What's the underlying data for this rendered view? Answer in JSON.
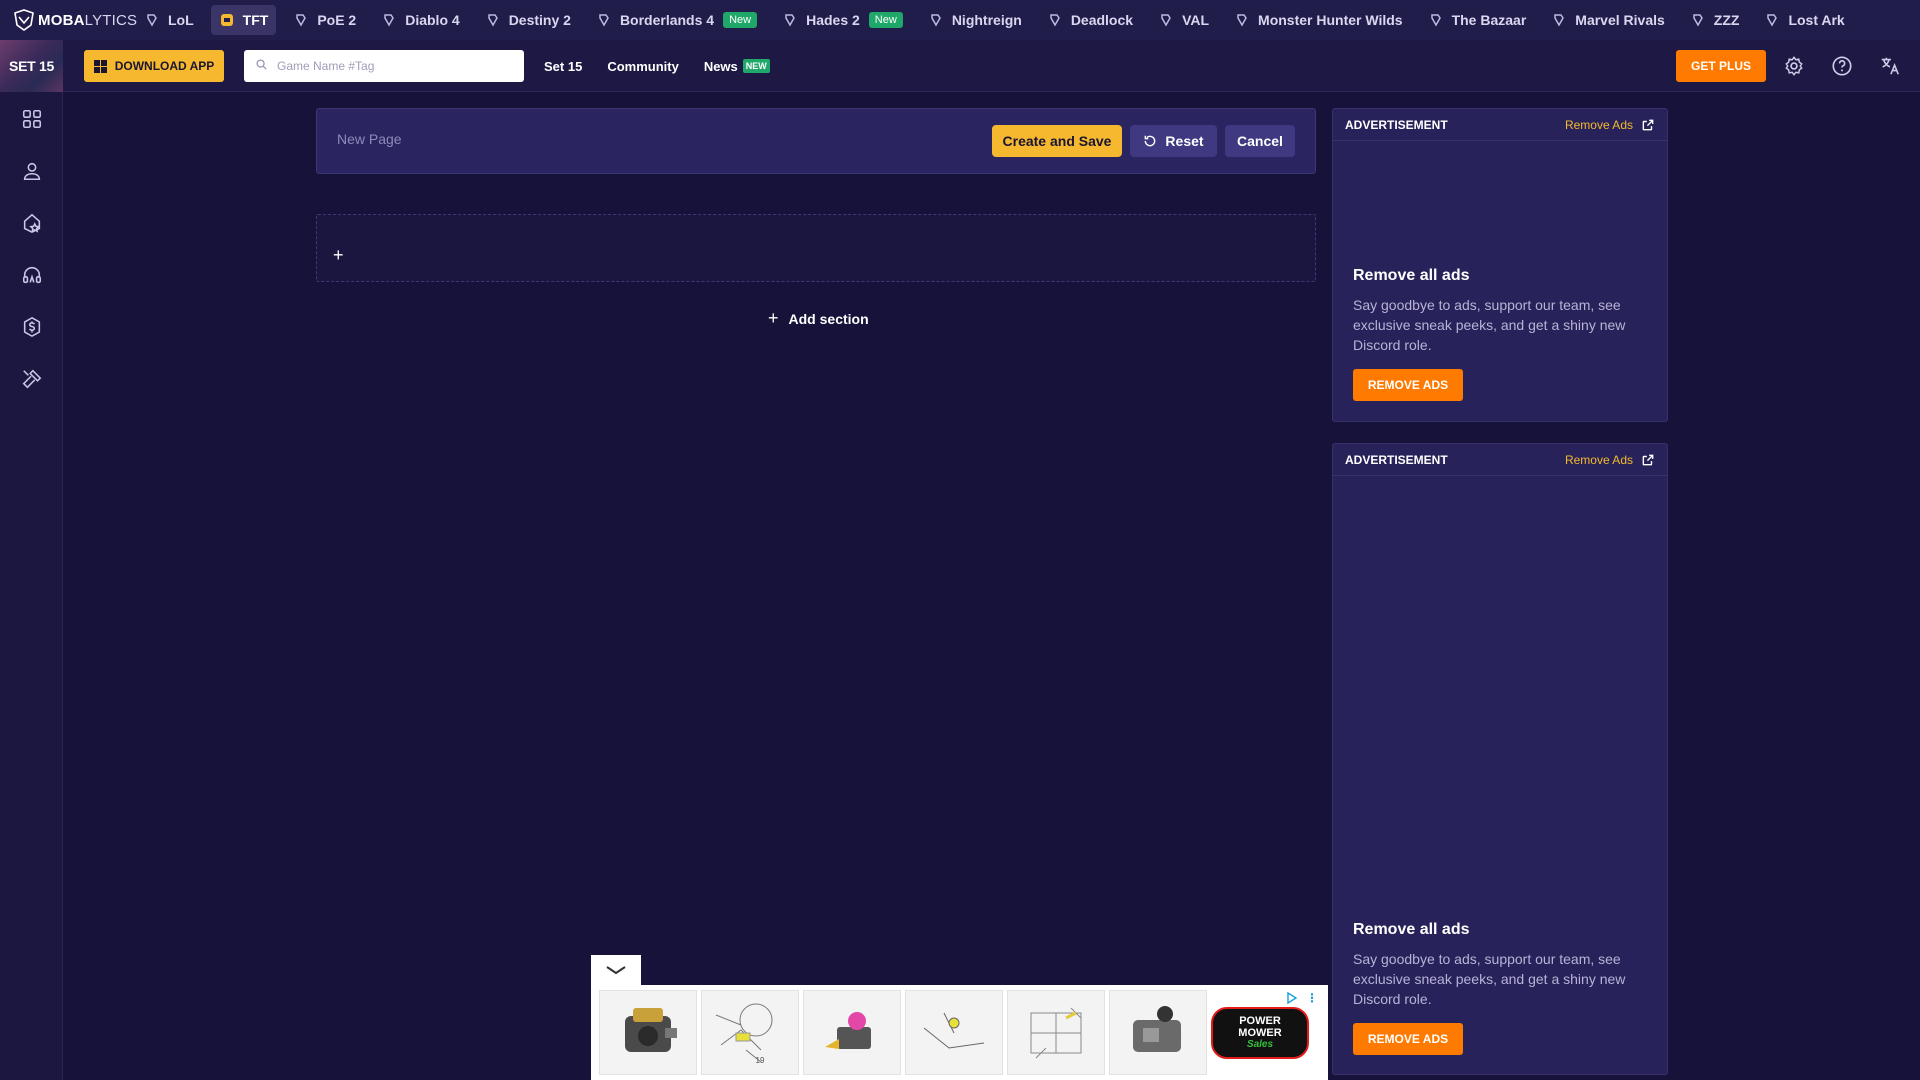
{
  "brand": {
    "bold": "MOBA",
    "thin": "LYTICS"
  },
  "games": [
    {
      "label": "LoL",
      "icon": "lol-icon",
      "active": false,
      "new": false
    },
    {
      "label": "TFT",
      "icon": "tft-icon",
      "active": true,
      "new": false
    },
    {
      "label": "PoE 2",
      "icon": "poe2-icon",
      "active": false,
      "new": false
    },
    {
      "label": "Diablo 4",
      "icon": "diablo4-icon",
      "active": false,
      "new": false
    },
    {
      "label": "Destiny 2",
      "icon": "destiny2-icon",
      "active": false,
      "new": false
    },
    {
      "label": "Borderlands 4",
      "icon": "borderlands4-icon",
      "active": false,
      "new": true
    },
    {
      "label": "Hades 2",
      "icon": "hades2-icon",
      "active": false,
      "new": true
    },
    {
      "label": "Nightreign",
      "icon": "nightreign-icon",
      "active": false,
      "new": false
    },
    {
      "label": "Deadlock",
      "icon": "deadlock-icon",
      "active": false,
      "new": false
    },
    {
      "label": "VAL",
      "icon": "valorant-icon",
      "active": false,
      "new": false
    },
    {
      "label": "Monster Hunter Wilds",
      "icon": "mhw-icon",
      "active": false,
      "new": false
    },
    {
      "label": "The Bazaar",
      "icon": "bazaar-icon",
      "active": false,
      "new": false
    },
    {
      "label": "Marvel Rivals",
      "icon": "marvel-rivals-icon",
      "active": false,
      "new": false
    },
    {
      "label": "ZZZ",
      "icon": "zzz-icon",
      "active": false,
      "new": false
    },
    {
      "label": "Lost Ark",
      "icon": "lost-ark-icon",
      "active": false,
      "new": false
    }
  ],
  "new_badge": "New",
  "subbar": {
    "set_tile": "SET 15",
    "download_label": "DOWNLOAD APP",
    "search_placeholder": "Game Name #Tag",
    "nav": [
      {
        "label": "Set 15",
        "badge": ""
      },
      {
        "label": "Community",
        "badge": ""
      },
      {
        "label": "News",
        "badge": "NEW"
      }
    ],
    "get_plus": "GET PLUS"
  },
  "rail": [
    "grid-icon",
    "profile-icon",
    "champion-icon",
    "headset-icon",
    "coin-icon",
    "tools-icon"
  ],
  "editor": {
    "title_placeholder": "New Page",
    "create_label": "Create and Save",
    "reset_label": "Reset",
    "cancel_label": "Cancel",
    "section_plus": "+",
    "add_section_label": "Add section"
  },
  "ads": {
    "label": "ADVERTISEMENT",
    "remove_link": "Remove Ads",
    "title": "Remove all ads",
    "text": "Say goodbye to ads, support our team, see exclusive sneak peeks, and get a shiny new Discord role.",
    "button": "REMOVE ADS"
  },
  "banner": {
    "thumbs": [
      "engine-icon",
      "diagram-icon",
      "carburetor-icon",
      "diagram-icon",
      "diagram-icon",
      "engine-icon"
    ],
    "thumb_numbers": [
      "",
      "19",
      "",
      "26 31",
      "",
      ""
    ],
    "logo_top": "POWER MOWER",
    "logo_bottom": "Sales"
  },
  "colors": {
    "accent_yellow": "#f5b82e",
    "accent_orange": "#ff7a00",
    "new_green": "#1fa86a",
    "background": "#16123a"
  }
}
